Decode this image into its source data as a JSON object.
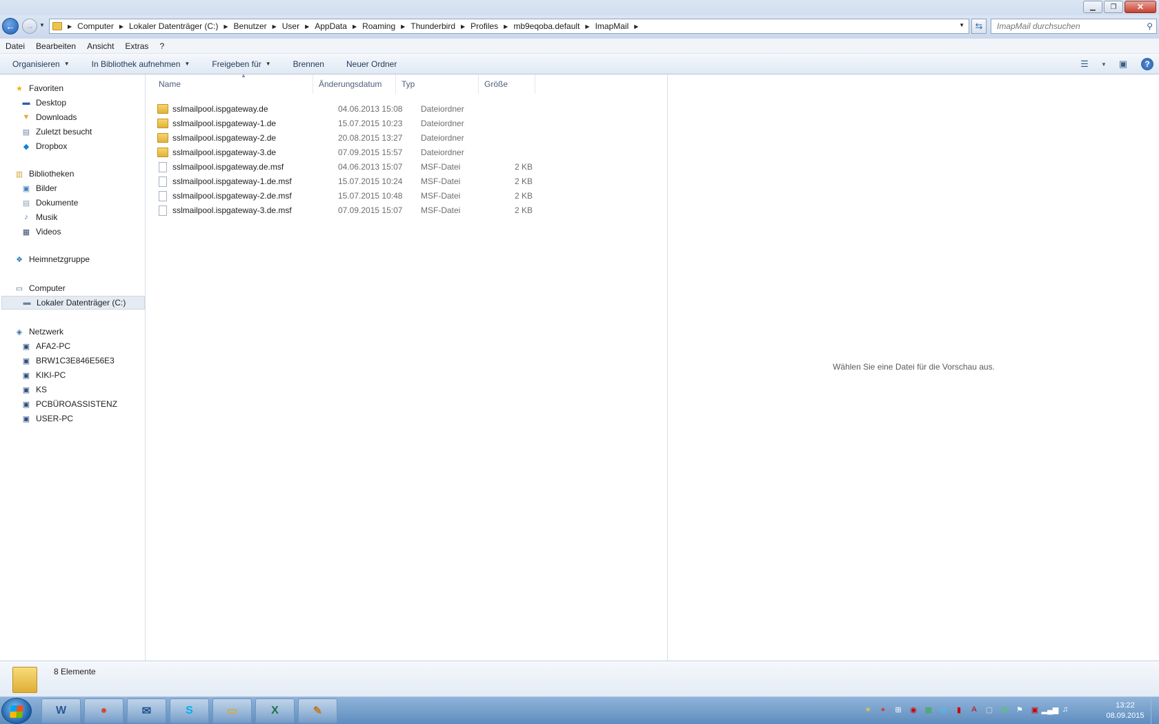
{
  "breadcrumb": [
    "Computer",
    "Lokaler Datenträger (C:)",
    "Benutzer",
    "User",
    "AppData",
    "Roaming",
    "Thunderbird",
    "Profiles",
    "mb9eqoba.default",
    "ImapMail"
  ],
  "search": {
    "placeholder": "ImapMail durchsuchen"
  },
  "menu": [
    "Datei",
    "Bearbeiten",
    "Ansicht",
    "Extras",
    "?"
  ],
  "commands": [
    {
      "label": "Organisieren",
      "caret": true
    },
    {
      "label": "In Bibliothek aufnehmen",
      "caret": true
    },
    {
      "label": "Freigeben für",
      "caret": true
    },
    {
      "label": "Brennen",
      "caret": false
    },
    {
      "label": "Neuer Ordner",
      "caret": false
    }
  ],
  "nav": {
    "favorites": {
      "label": "Favoriten",
      "items": [
        "Desktop",
        "Downloads",
        "Zuletzt besucht",
        "Dropbox"
      ]
    },
    "libraries": {
      "label": "Bibliotheken",
      "items": [
        "Bilder",
        "Dokumente",
        "Musik",
        "Videos"
      ]
    },
    "homegroup": {
      "label": "Heimnetzgruppe"
    },
    "computer": {
      "label": "Computer",
      "items": [
        "Lokaler Datenträger (C:)"
      ]
    },
    "network": {
      "label": "Netzwerk",
      "items": [
        "AFA2-PC",
        "BRW1C3E846E56E3",
        "KIKI-PC",
        "KS",
        "PCBÜROASSISTENZ",
        "USER-PC"
      ]
    }
  },
  "columns": {
    "name": "Name",
    "date": "Änderungsdatum",
    "type": "Typ",
    "size": "Größe"
  },
  "files": [
    {
      "name": "sslmailpool.ispgateway.de",
      "date": "04.06.2013 15:08",
      "type": "Dateiordner",
      "size": "",
      "kind": "folder"
    },
    {
      "name": "sslmailpool.ispgateway-1.de",
      "date": "15.07.2015 10:23",
      "type": "Dateiordner",
      "size": "",
      "kind": "folder"
    },
    {
      "name": "sslmailpool.ispgateway-2.de",
      "date": "20.08.2015 13:27",
      "type": "Dateiordner",
      "size": "",
      "kind": "folder"
    },
    {
      "name": "sslmailpool.ispgateway-3.de",
      "date": "07.09.2015 15:57",
      "type": "Dateiordner",
      "size": "",
      "kind": "folder"
    },
    {
      "name": "sslmailpool.ispgateway.de.msf",
      "date": "04.06.2013 15:07",
      "type": "MSF-Datei",
      "size": "2 KB",
      "kind": "file"
    },
    {
      "name": "sslmailpool.ispgateway-1.de.msf",
      "date": "15.07.2015 10:24",
      "type": "MSF-Datei",
      "size": "2 KB",
      "kind": "file"
    },
    {
      "name": "sslmailpool.ispgateway-2.de.msf",
      "date": "15.07.2015 10:48",
      "type": "MSF-Datei",
      "size": "2 KB",
      "kind": "file"
    },
    {
      "name": "sslmailpool.ispgateway-3.de.msf",
      "date": "07.09.2015 15:07",
      "type": "MSF-Datei",
      "size": "2 KB",
      "kind": "file"
    }
  ],
  "preview": {
    "message": "Wählen Sie eine Datei für die Vorschau aus."
  },
  "details": {
    "count": "8 Elemente"
  },
  "taskbar": {
    "apps": [
      {
        "name": "word-icon",
        "glyph": "W",
        "color": "#2b5797"
      },
      {
        "name": "chrome-icon",
        "glyph": "●",
        "color": "#db4437"
      },
      {
        "name": "thunderbird-icon",
        "glyph": "✉",
        "color": "#1f4e8c"
      },
      {
        "name": "skype-icon",
        "glyph": "S",
        "color": "#00aff0"
      },
      {
        "name": "explorer-icon",
        "glyph": "▭",
        "color": "#d9a730"
      },
      {
        "name": "excel-icon",
        "glyph": "X",
        "color": "#1e7145"
      },
      {
        "name": "paint-icon",
        "glyph": "✎",
        "color": "#c07a2c"
      }
    ],
    "time": "13:22",
    "date": "08.09.2015"
  }
}
